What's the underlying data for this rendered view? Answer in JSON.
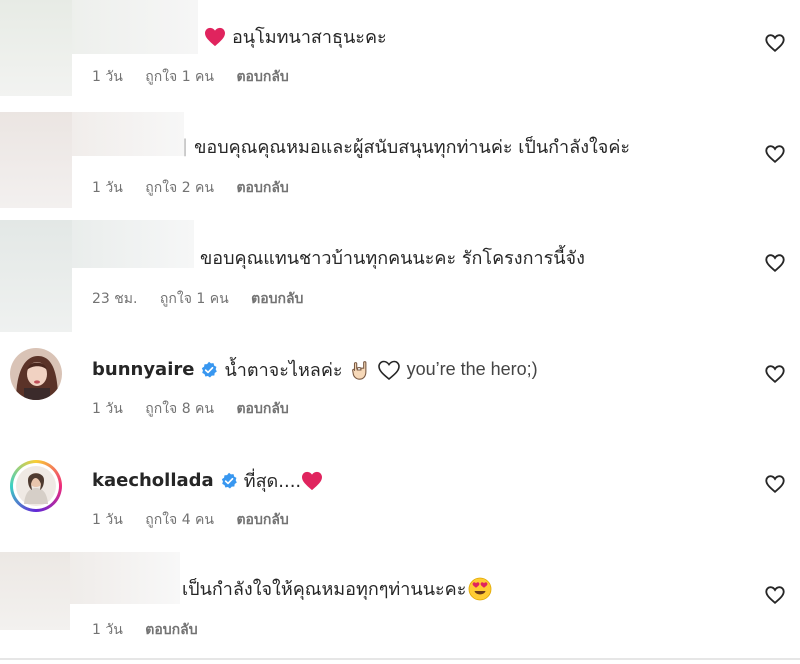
{
  "comments": [
    {
      "text": "อนุโมทนาสาธุนะคะ",
      "time": "1 วัน",
      "likes": "ถูกใจ 1 คน",
      "reply": "ตอบกลับ"
    },
    {
      "text": "ขอบคุณคุณหมอและผู้สนับสนุนทุกท่านค่ะ เป็นกำลังใจค่ะ",
      "time": "1 วัน",
      "likes": "ถูกใจ 2 คน",
      "reply": "ตอบกลับ"
    },
    {
      "text": "ขอบคุณแทนชาวบ้านทุกคนนะคะ รักโครงการนี้จัง",
      "time": "23 ชม.",
      "likes": "ถูกใจ 1 คน",
      "reply": "ตอบกลับ"
    },
    {
      "username": "bunnyaire",
      "text_before": "น้ำตาจะไหลค่ะ",
      "text_after": "you’re the hero;)",
      "time": "1 วัน",
      "likes": "ถูกใจ 8 คน",
      "reply": "ตอบกลับ"
    },
    {
      "username": "kaechollada",
      "text": "ที่สุด....",
      "time": "1 วัน",
      "likes": "ถูกใจ 4 คน",
      "reply": "ตอบกลับ"
    },
    {
      "text": "เป็นกำลังใจให้คุณหมอทุกๆท่านนะคะ",
      "time": "1 วัน",
      "reply": "ตอบกลับ"
    }
  ],
  "colors": {
    "verified": "#3897f0",
    "red_heart": "#e0245e",
    "meta_text": "#737373",
    "main_text": "#262626"
  },
  "icons": [
    "heart-icon",
    "verified-badge-icon",
    "red-heart-emoji",
    "rock-hand-emoji",
    "heart-eyes-emoji"
  ]
}
